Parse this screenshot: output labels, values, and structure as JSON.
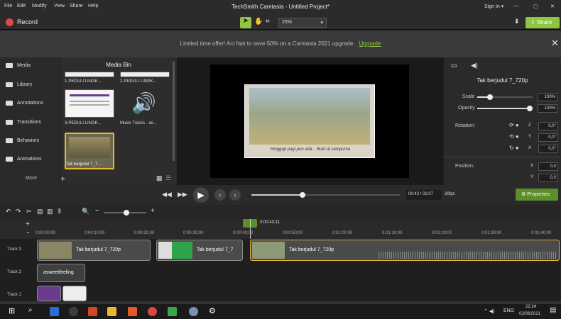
{
  "menu": [
    "File",
    "Edit",
    "Modify",
    "View",
    "Share",
    "Help"
  ],
  "title": "TechSmith Camtasia - Untitled Project*",
  "signin": "Sign In ▾",
  "record": "Record",
  "zoom": "25%",
  "share": "Share",
  "promo": {
    "text": "Limited time offer! Act fast to save 50% on a Camtasia 2021 upgrade.",
    "link": "Upgrade"
  },
  "nav": [
    "Media",
    "Library",
    "Annotations",
    "Transitions",
    "Behaviors",
    "Animations"
  ],
  "more": "More",
  "bin": {
    "title": "Media Bin",
    "items": [
      "1-PEDULI LINGK...",
      "2-PEDULI LINGK...",
      "3-PEDULI LINGK...",
      "Music Tracks - as...",
      "Tak berjudul 7_7..."
    ]
  },
  "caption": "Hinggap pagi pun ada... Butir-al sempurna",
  "props": {
    "title": "Tak berjudul 7_720p",
    "scale_label": "Scale",
    "scale": "100%",
    "opacity_label": "Opacity",
    "opacity": "100%",
    "rotation_label": "Rotation:",
    "rz": "0,0°",
    "ry": "0,0°",
    "rx": "0,0°",
    "position_label": "Position:",
    "px": "0,0",
    "py": "0,0"
  },
  "playback": {
    "time": "00:43 / 02:07",
    "fps": "30fps",
    "properties": "Properties"
  },
  "playhead_time": "0:00:43;11",
  "ruler": [
    "0:00:00;00",
    "0:00:10;00",
    "0:00:20;00",
    "0:00:30;00",
    "0:00:40;00",
    "0:00:50;00",
    "0:01:00;00",
    "0:01:10;00",
    "0:01:20;00",
    "0:01:30;00",
    "0:01:40;00"
  ],
  "tracks": [
    {
      "label": "Track 3"
    },
    {
      "label": "Track 2"
    },
    {
      "label": "Track 1"
    }
  ],
  "clips": {
    "t3a": "Tak berjudul 7_720p",
    "t3b": "Tak berjudul 7_7",
    "t3c": "Tak berjudul 7_720p",
    "t2": "asweetfeeling"
  },
  "tray": {
    "lang": "ENG",
    "time": "22:24",
    "date": "02/08/2021"
  }
}
